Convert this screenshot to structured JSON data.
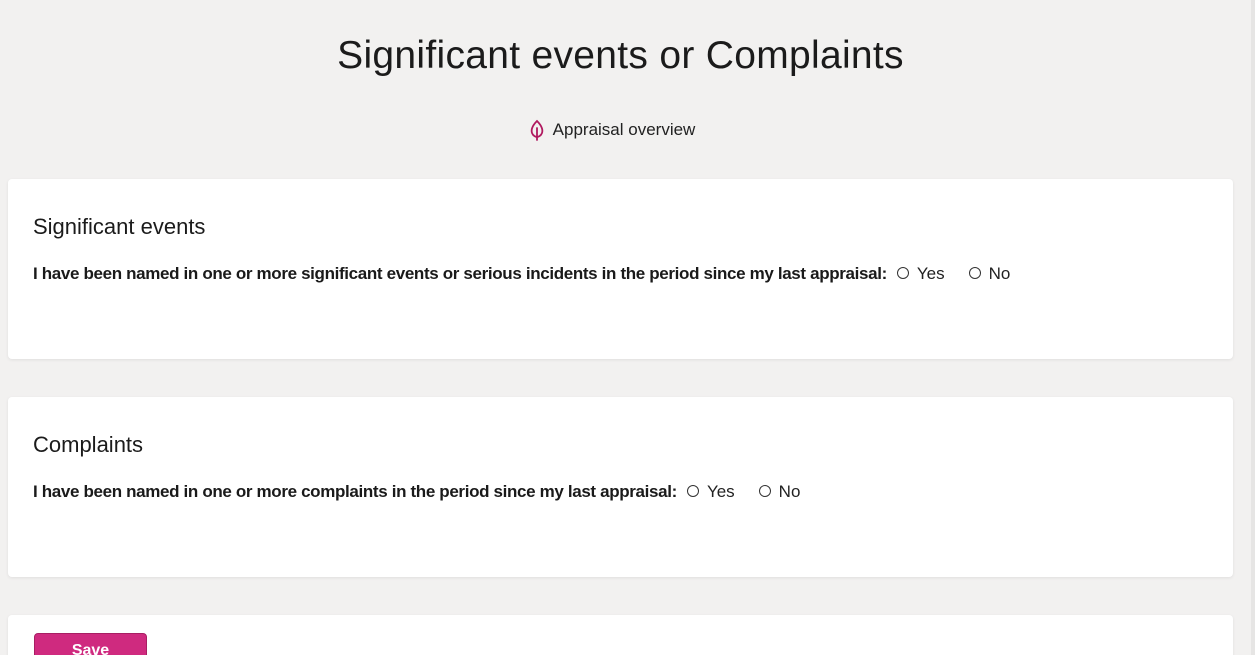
{
  "page": {
    "title": "Significant events or Complaints",
    "overview_link": "Appraisal overview",
    "overview_icon": "leaf-icon",
    "accent_color": "#cf2a7f"
  },
  "significant_events": {
    "heading": "Significant events",
    "question": "I have been named in one or more significant events or serious incidents in the period since my last appraisal:",
    "options": [
      "Yes",
      "No"
    ]
  },
  "complaints": {
    "heading": "Complaints",
    "question": "I have been named in one or more complaints in the period since my last appraisal:",
    "options": [
      "Yes",
      "No"
    ]
  },
  "actions": {
    "save_label": "Save"
  }
}
